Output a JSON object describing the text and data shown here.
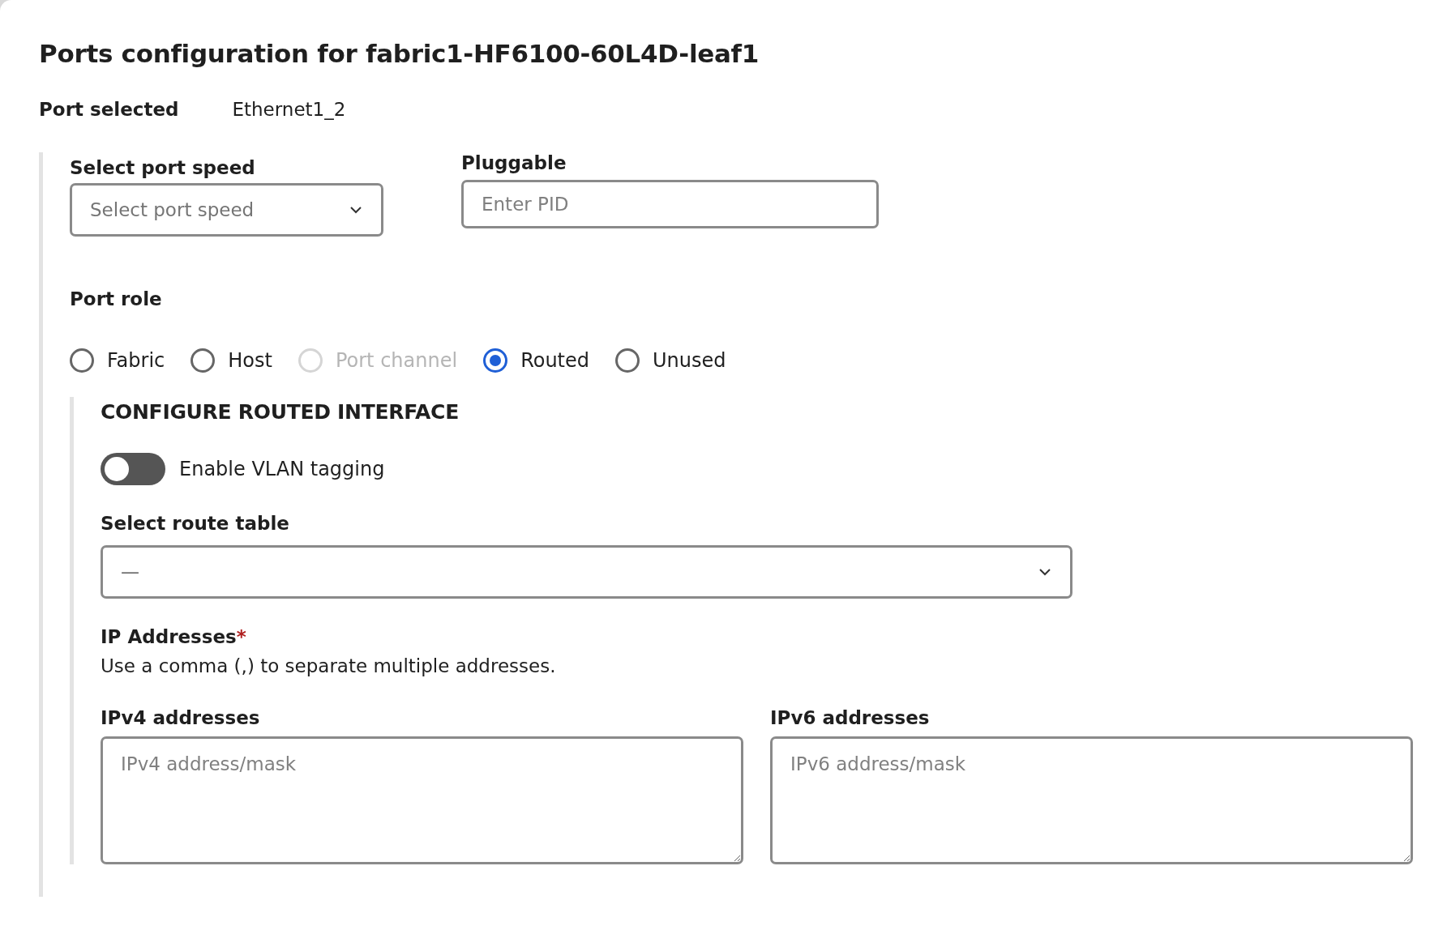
{
  "title": "Ports configuration for fabric1-HF6100-60L4D-leaf1",
  "port_selected": {
    "label": "Port selected",
    "value": "Ethernet1_2"
  },
  "port_speed": {
    "label": "Select port speed",
    "placeholder": "Select port speed"
  },
  "pluggable": {
    "label": "Pluggable",
    "placeholder": "Enter PID"
  },
  "port_role": {
    "label": "Port role",
    "options": [
      {
        "label": "Fabric",
        "selected": false,
        "disabled": false
      },
      {
        "label": "Host",
        "selected": false,
        "disabled": false
      },
      {
        "label": "Port channel",
        "selected": false,
        "disabled": true
      },
      {
        "label": "Routed",
        "selected": true,
        "disabled": false
      },
      {
        "label": "Unused",
        "selected": false,
        "disabled": false
      }
    ]
  },
  "routed": {
    "heading": "CONFIGURE ROUTED INTERFACE",
    "vlan_toggle": {
      "label": "Enable VLAN tagging",
      "on": false
    },
    "route_table": {
      "label": "Select route table",
      "value": "—"
    },
    "ip": {
      "label": "IP Addresses",
      "required_mark": "*",
      "help": "Use a comma (,) to separate multiple addresses.",
      "fields": [
        {
          "label": "IPv4 addresses",
          "placeholder": "IPv4 address/mask"
        },
        {
          "label": "IPv6 addresses",
          "placeholder": "IPv6 address/mask"
        }
      ]
    }
  }
}
